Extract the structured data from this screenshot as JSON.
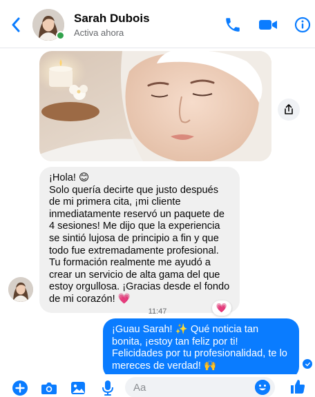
{
  "header": {
    "contact_name": "Sarah Dubois",
    "status": "Activa ahora"
  },
  "icons": {
    "back": "back-arrow-icon",
    "call": "phone-icon",
    "video": "video-camera-icon",
    "info": "info-icon",
    "share": "share-icon",
    "add": "plus-icon",
    "camera": "camera-icon",
    "gallery": "image-icon",
    "mic": "microphone-icon",
    "emoji": "smiley-icon",
    "like": "thumbs-up-icon"
  },
  "colors": {
    "accent": "#0a7cff",
    "online": "#31a24c",
    "incoming_bubble": "#f0f0f0"
  },
  "messages": {
    "incoming_text": "¡Hola! 😊\nSolo quería decirte que justo después de mi primera cita, ¡mi cliente inmediatamente reservó un paquete de 4 sesiones! Me dijo que la experiencia se sintió lujosa de principio a fin y que todo fue extremadamente profesional. Tu formación realmente me ayudó a crear un servicio de alta gama del que estoy orgullosa. ¡Gracias desde el fondo de mi corazón! 💗",
    "reaction": "💗",
    "timestamp": "11:47",
    "outgoing_text": "¡Guau Sarah! ✨ Qué noticia tan bonita, ¡estoy tan feliz por ti! Felicidades por tu profesionalidad, te lo mereces de verdad! 🙌"
  },
  "composer": {
    "placeholder": "Aa"
  }
}
